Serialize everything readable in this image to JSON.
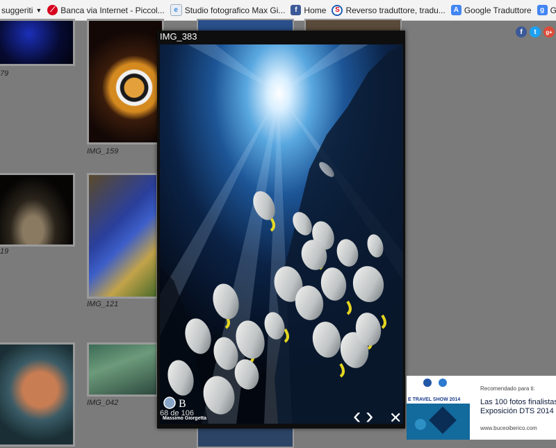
{
  "bookmarks": [
    {
      "label": "suggeriti",
      "icon": "dropdown-caret"
    },
    {
      "label": "Banca via Internet - Piccol...",
      "icon": "unicredit-icon",
      "color": "#d6001c"
    },
    {
      "label": "Studio fotografico Max Gi...",
      "icon": "ie-page-icon",
      "color": "#3b8ad8"
    },
    {
      "label": "Home",
      "icon": "facebook-icon",
      "color": "#3b5998"
    },
    {
      "label": "Reverso  traduttore, tradu...",
      "icon": "reverso-icon",
      "color": "#1d5fb4"
    },
    {
      "label": "Google Traduttore",
      "icon": "google-translate-icon",
      "color": "#4285f4"
    },
    {
      "label": "Google",
      "icon": "google-icon",
      "color": "#4285f4"
    }
  ],
  "gallery": {
    "captions": [
      "79",
      "IMG_159",
      "19",
      "IMG_121",
      "IMG_042"
    ]
  },
  "social": {
    "facebook": "f",
    "twitter": "t",
    "googleplus": "g+"
  },
  "lightbox": {
    "title": "IMG_383",
    "counter": "68 de 106",
    "prev": "‹",
    "next": "›",
    "close": "✕",
    "watermark": "Massimo Giorgetta"
  },
  "ad": {
    "recommended": "Recomendado para ti:",
    "line1": "Las 100 fotos finalistas",
    "line2": "Exposición DTS 2014 -",
    "source": "www.buceoiberico.com",
    "banner": "E TRAVEL SHOW 2014"
  }
}
